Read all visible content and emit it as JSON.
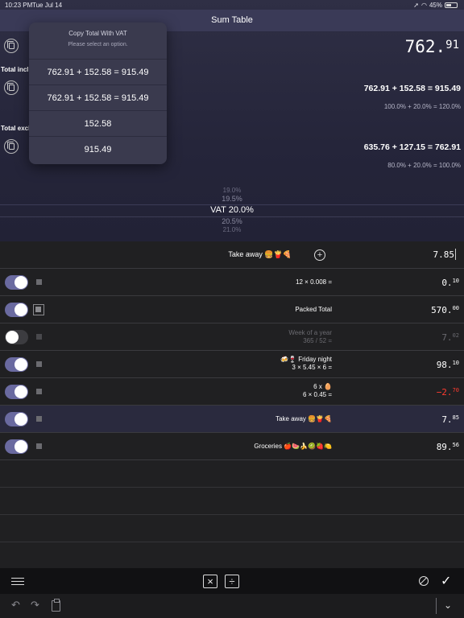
{
  "status": {
    "time": "10:23 PM",
    "date": "Tue Jul 14",
    "battery": "45%"
  },
  "nav": {
    "title": "Sum Table"
  },
  "summary": {
    "total_label": "762.",
    "total_cents": "91",
    "incl_label": "Total incl",
    "incl_equation": "762.91 + 152.58 = 915.49",
    "incl_percent": "100.0% + 20.0% = 120.0%",
    "excl_label": "Total excl",
    "excl_equation": "635.76 + 127.15 = 762.91",
    "excl_percent": "80.0% + 20.0% = 100.0%"
  },
  "vat_picker": {
    "above2": "19.0%",
    "above1": "19.5%",
    "selected": "VAT 20.0%",
    "below1": "20.5%",
    "below2": "21.0%"
  },
  "popover": {
    "title": "Copy Total With VAT",
    "subtitle": "Please select an option.",
    "options": [
      "762.91 + 152.58 = 915.49",
      "762.91 + 152.58 = 915.49",
      "152.58",
      "915.49"
    ]
  },
  "entry": {
    "description": "Take away 🍔🍟🍕",
    "value": "7.85"
  },
  "rows": [
    {
      "line1": "12 × 0.008 =",
      "line2": "",
      "int": "0.",
      "dec": "10",
      "on": true
    },
    {
      "line1": "Packed Total",
      "line2": "",
      "int": "570.",
      "dec": "00",
      "on": true
    },
    {
      "line1": "Week of a year",
      "line2": "365 / 52 =",
      "int": "7.",
      "dec": "02",
      "on": false
    },
    {
      "line1": "🍻🍷 Friday night",
      "line2": "3 × 5.45 × 6 =",
      "int": "98.",
      "dec": "10",
      "on": true
    },
    {
      "line1": "6 x 🥚",
      "line2": "6 × 0.45 =",
      "int": "−2.",
      "dec": "70",
      "on": true
    },
    {
      "line1": "Take away 🍔🍟🍕",
      "line2": "",
      "int": "7.",
      "dec": "85",
      "on": true
    },
    {
      "line1": "Groceries 🍎🍉🍌🥝🍓🍋",
      "line2": "",
      "int": "89.",
      "dec": "56",
      "on": true
    }
  ],
  "toolbar": {
    "multiply": "×",
    "divide": "÷",
    "check": "✓"
  },
  "keyboard_bar": {
    "undo": "↶",
    "redo": "↷",
    "chevron": "⌄"
  },
  "colors": {
    "accent": "#6a6aa0",
    "negative": "#ff3b30",
    "header": "#3a3a57"
  }
}
